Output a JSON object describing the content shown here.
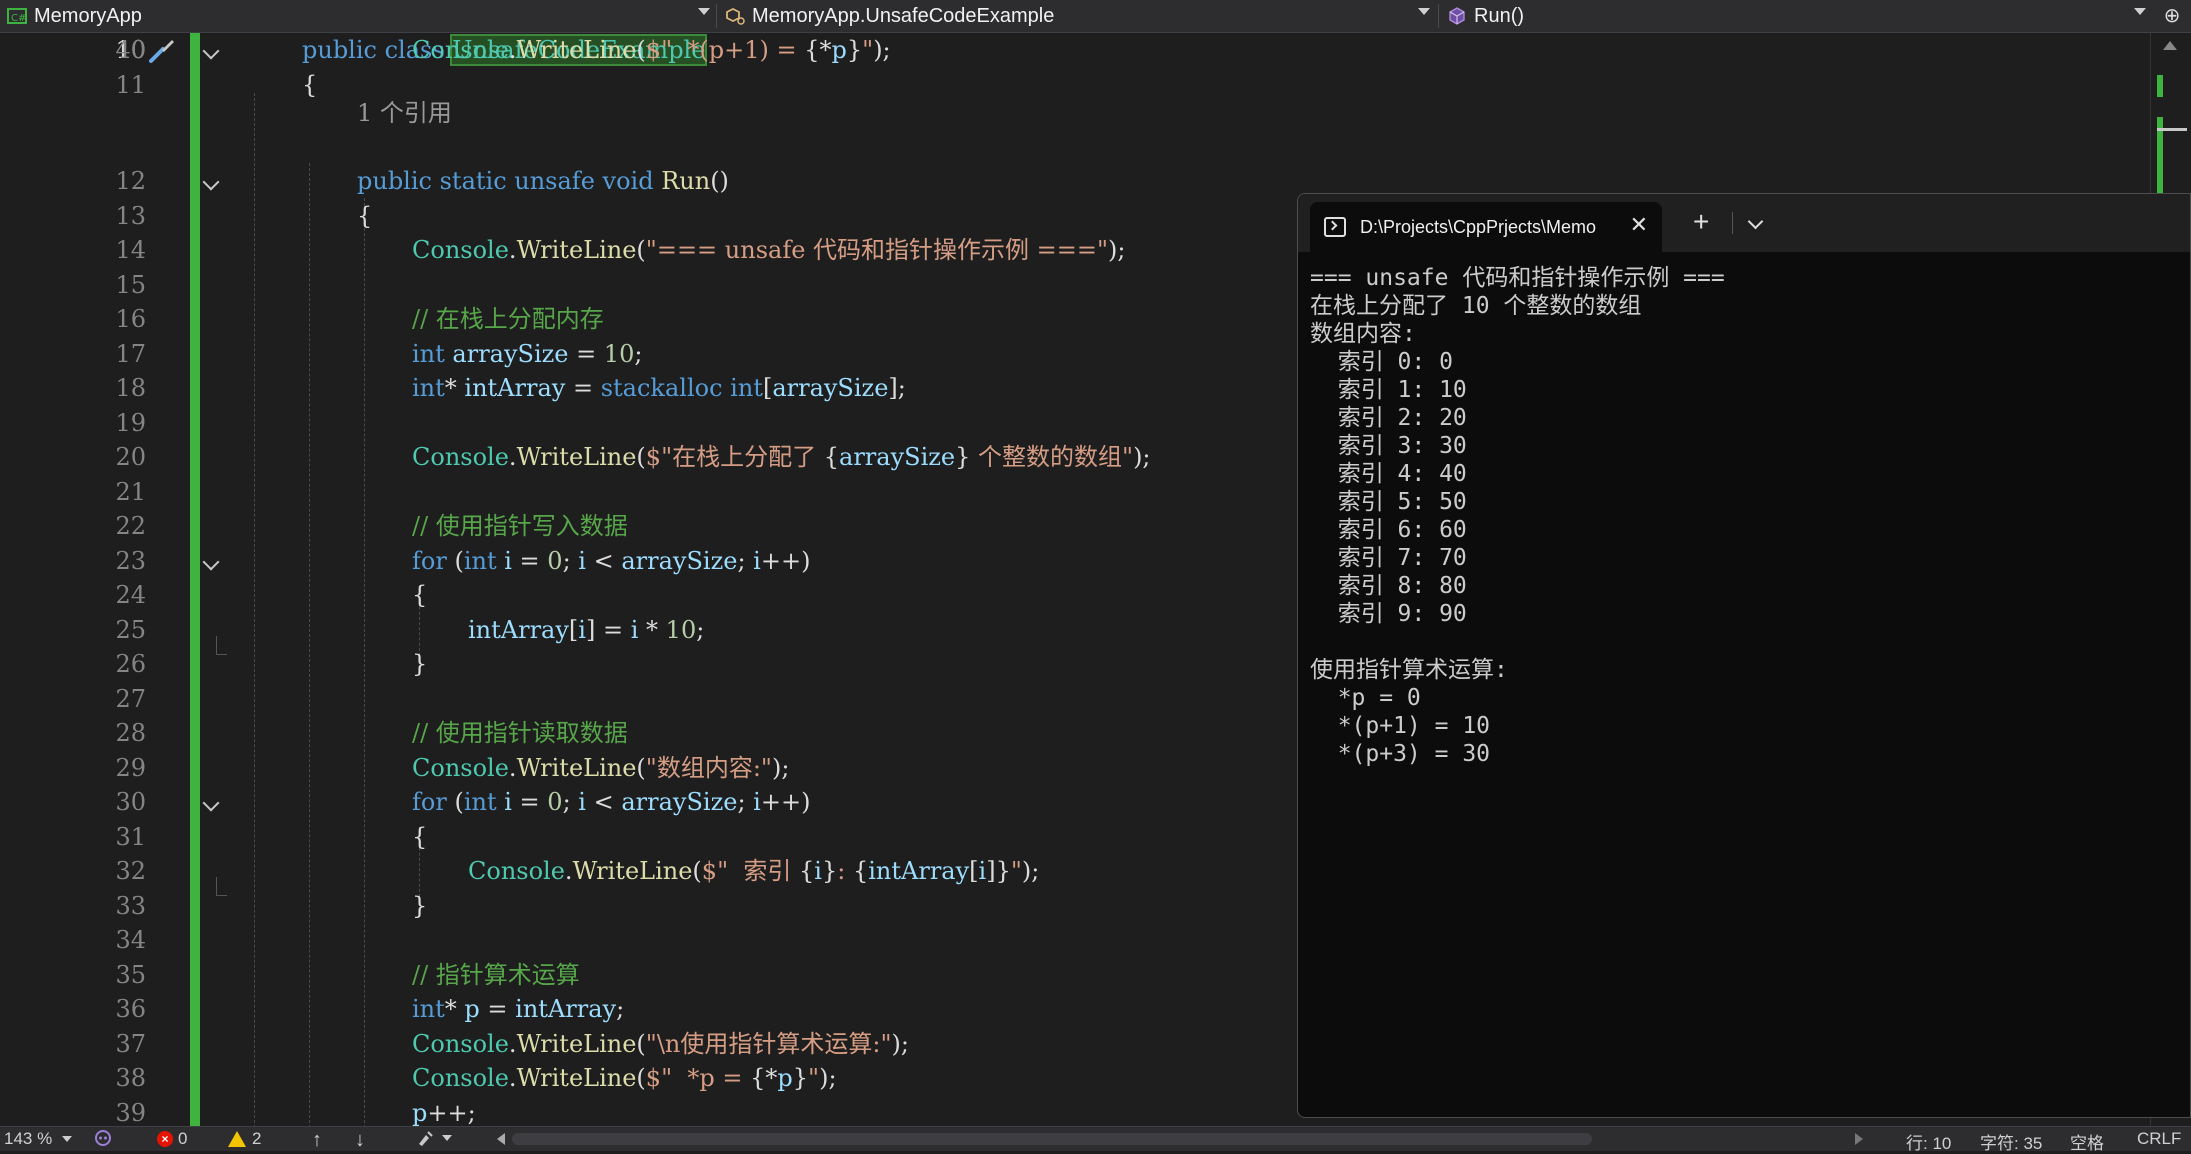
{
  "navbar": {
    "project": "MemoryApp",
    "type_scope": "MemoryApp.UnsafeCodeExample",
    "member": "Run()"
  },
  "editor": {
    "codelens": "1 个引用",
    "lines": [
      {
        "n": "10",
        "current": true,
        "fold": true,
        "indent": 0,
        "tokens": [
          [
            "kw",
            "public class "
          ],
          [
            "hl",
            "UnsafeCodeExample"
          ]
        ]
      },
      {
        "n": "11",
        "indent": 0,
        "tokens": [
          [
            "pl",
            "{"
          ]
        ]
      },
      {
        "n": "12",
        "fold": true,
        "indent": 1,
        "tokens": [
          [
            "kw",
            "public static unsafe void "
          ],
          [
            "fn",
            "Run"
          ],
          [
            "pl",
            "()"
          ]
        ]
      },
      {
        "n": "13",
        "indent": 1,
        "tokens": [
          [
            "pl",
            "{"
          ]
        ]
      },
      {
        "n": "14",
        "indent": 2,
        "tokens": [
          [
            "ty",
            "Console"
          ],
          [
            "pl",
            "."
          ],
          [
            "fn",
            "WriteLine"
          ],
          [
            "pl",
            "("
          ],
          [
            "str",
            "\"=== unsafe 代码和指针操作示例 ===\""
          ],
          [
            "pl",
            ");"
          ]
        ]
      },
      {
        "n": "15",
        "indent": 2,
        "tokens": []
      },
      {
        "n": "16",
        "indent": 2,
        "tokens": [
          [
            "cm",
            "// 在栈上分配内存"
          ]
        ]
      },
      {
        "n": "17",
        "indent": 2,
        "tokens": [
          [
            "kw",
            "int "
          ],
          [
            "var",
            "arraySize"
          ],
          [
            "pl",
            " = "
          ],
          [
            "num",
            "10"
          ],
          [
            "pl",
            ";"
          ]
        ]
      },
      {
        "n": "18",
        "indent": 2,
        "tokens": [
          [
            "kw",
            "int"
          ],
          [
            "pl",
            "* "
          ],
          [
            "var",
            "intArray"
          ],
          [
            "pl",
            " = "
          ],
          [
            "kw",
            "stackalloc int"
          ],
          [
            "pl",
            "["
          ],
          [
            "var",
            "arraySize"
          ],
          [
            "pl",
            "];"
          ]
        ]
      },
      {
        "n": "19",
        "indent": 2,
        "tokens": []
      },
      {
        "n": "20",
        "indent": 2,
        "tokens": [
          [
            "ty",
            "Console"
          ],
          [
            "pl",
            "."
          ],
          [
            "fn",
            "WriteLine"
          ],
          [
            "pl",
            "("
          ],
          [
            "str",
            "$\"在栈上分配了 "
          ],
          [
            "pl",
            "{"
          ],
          [
            "var",
            "arraySize"
          ],
          [
            "pl",
            "}"
          ],
          [
            "str",
            " 个整数的数组\""
          ],
          [
            "pl",
            ");"
          ]
        ]
      },
      {
        "n": "21",
        "indent": 2,
        "tokens": []
      },
      {
        "n": "22",
        "indent": 2,
        "tokens": [
          [
            "cm",
            "// 使用指针写入数据"
          ]
        ]
      },
      {
        "n": "23",
        "fold": true,
        "indent": 2,
        "tokens": [
          [
            "kw",
            "for "
          ],
          [
            "pl",
            "("
          ],
          [
            "kw",
            "int "
          ],
          [
            "var",
            "i"
          ],
          [
            "pl",
            " = "
          ],
          [
            "num",
            "0"
          ],
          [
            "pl",
            "; "
          ],
          [
            "var",
            "i"
          ],
          [
            "pl",
            " < "
          ],
          [
            "var",
            "arraySize"
          ],
          [
            "pl",
            "; "
          ],
          [
            "var",
            "i"
          ],
          [
            "pl",
            "++)"
          ]
        ]
      },
      {
        "n": "24",
        "indent": 2,
        "tokens": [
          [
            "pl",
            "{"
          ]
        ]
      },
      {
        "n": "25",
        "indent": 3,
        "tokens": [
          [
            "var",
            "intArray"
          ],
          [
            "pl",
            "["
          ],
          [
            "var",
            "i"
          ],
          [
            "pl",
            "] = "
          ],
          [
            "var",
            "i"
          ],
          [
            "pl",
            " * "
          ],
          [
            "num",
            "10"
          ],
          [
            "pl",
            ";"
          ]
        ]
      },
      {
        "n": "26",
        "indent": 2,
        "tokens": [
          [
            "pl",
            "}"
          ]
        ]
      },
      {
        "n": "27",
        "indent": 2,
        "tokens": []
      },
      {
        "n": "28",
        "indent": 2,
        "tokens": [
          [
            "cm",
            "// 使用指针读取数据"
          ]
        ]
      },
      {
        "n": "29",
        "indent": 2,
        "tokens": [
          [
            "ty",
            "Console"
          ],
          [
            "pl",
            "."
          ],
          [
            "fn",
            "WriteLine"
          ],
          [
            "pl",
            "("
          ],
          [
            "str",
            "\"数组内容:\""
          ],
          [
            "pl",
            ");"
          ]
        ]
      },
      {
        "n": "30",
        "fold": true,
        "indent": 2,
        "tokens": [
          [
            "kw",
            "for "
          ],
          [
            "pl",
            "("
          ],
          [
            "kw",
            "int "
          ],
          [
            "var",
            "i"
          ],
          [
            "pl",
            " = "
          ],
          [
            "num",
            "0"
          ],
          [
            "pl",
            "; "
          ],
          [
            "var",
            "i"
          ],
          [
            "pl",
            " < "
          ],
          [
            "var",
            "arraySize"
          ],
          [
            "pl",
            "; "
          ],
          [
            "var",
            "i"
          ],
          [
            "pl",
            "++)"
          ]
        ]
      },
      {
        "n": "31",
        "indent": 2,
        "tokens": [
          [
            "pl",
            "{"
          ]
        ]
      },
      {
        "n": "32",
        "indent": 3,
        "tokens": [
          [
            "ty",
            "Console"
          ],
          [
            "pl",
            "."
          ],
          [
            "fn",
            "WriteLine"
          ],
          [
            "pl",
            "("
          ],
          [
            "str",
            "$\"  索引 "
          ],
          [
            "pl",
            "{"
          ],
          [
            "var",
            "i"
          ],
          [
            "pl",
            "}"
          ],
          [
            "str",
            ": "
          ],
          [
            "pl",
            "{"
          ],
          [
            "var",
            "intArray"
          ],
          [
            "pl",
            "["
          ],
          [
            "var",
            "i"
          ],
          [
            "pl",
            "]}"
          ],
          [
            "str",
            "\""
          ],
          [
            "pl",
            ");"
          ]
        ]
      },
      {
        "n": "33",
        "indent": 2,
        "tokens": [
          [
            "pl",
            "}"
          ]
        ]
      },
      {
        "n": "34",
        "indent": 2,
        "tokens": []
      },
      {
        "n": "35",
        "indent": 2,
        "tokens": [
          [
            "cm",
            "// 指针算术运算"
          ]
        ]
      },
      {
        "n": "36",
        "indent": 2,
        "tokens": [
          [
            "kw",
            "int"
          ],
          [
            "pl",
            "* "
          ],
          [
            "var",
            "p"
          ],
          [
            "pl",
            " = "
          ],
          [
            "var",
            "intArray"
          ],
          [
            "pl",
            ";"
          ]
        ]
      },
      {
        "n": "37",
        "indent": 2,
        "tokens": [
          [
            "ty",
            "Console"
          ],
          [
            "pl",
            "."
          ],
          [
            "fn",
            "WriteLine"
          ],
          [
            "pl",
            "("
          ],
          [
            "str",
            "\"\\n使用指针算术运算:\""
          ],
          [
            "pl",
            ");"
          ]
        ]
      },
      {
        "n": "38",
        "indent": 2,
        "tokens": [
          [
            "ty",
            "Console"
          ],
          [
            "pl",
            "."
          ],
          [
            "fn",
            "WriteLine"
          ],
          [
            "pl",
            "("
          ],
          [
            "str",
            "$\"  *p = "
          ],
          [
            "pl",
            "{*"
          ],
          [
            "var",
            "p"
          ],
          [
            "pl",
            "}"
          ],
          [
            "str",
            "\""
          ],
          [
            "pl",
            ");"
          ]
        ]
      },
      {
        "n": "39",
        "indent": 2,
        "tokens": [
          [
            "var",
            "p"
          ],
          [
            "pl",
            "++;"
          ]
        ]
      },
      {
        "n": "40",
        "indent": 2,
        "tokens": [
          [
            "ty",
            "Console"
          ],
          [
            "pl",
            "."
          ],
          [
            "fn",
            "WriteLine"
          ],
          [
            "pl",
            "("
          ],
          [
            "str",
            "$\"  *(p+1) = "
          ],
          [
            "pl",
            "{*"
          ],
          [
            "var",
            "p"
          ],
          [
            "pl",
            "}"
          ],
          [
            "str",
            "\""
          ],
          [
            "pl",
            ");"
          ]
        ]
      }
    ]
  },
  "terminal": {
    "tab_title": "D:\\Projects\\CppPrjects\\Memo",
    "close_glyph": "✕",
    "new_tab_glyph": "+",
    "output": [
      "=== unsafe 代码和指针操作示例 ===",
      "在栈上分配了 10 个整数的数组",
      "数组内容:",
      "  索引 0: 0",
      "  索引 1: 10",
      "  索引 2: 20",
      "  索引 3: 30",
      "  索引 4: 40",
      "  索引 5: 50",
      "  索引 6: 60",
      "  索引 7: 70",
      "  索引 8: 80",
      "  索引 9: 90",
      "",
      "使用指针算术运算:",
      "  *p = 0",
      "  *(p+1) = 10",
      "  *(p+3) = 30"
    ]
  },
  "statusbar": {
    "zoom": "143 %",
    "errors": "0",
    "warnings": "2",
    "line": "行: 10",
    "char": "字符: 35",
    "spaces": "空格",
    "eol": "CRLF"
  },
  "colors": {
    "background": "#1e1e1e",
    "keyword": "#569cd6",
    "type": "#4ec9b0",
    "method": "#dcdcaa",
    "string": "#d69d85",
    "comment": "#57a64a",
    "change_bar": "#3fb33f"
  }
}
